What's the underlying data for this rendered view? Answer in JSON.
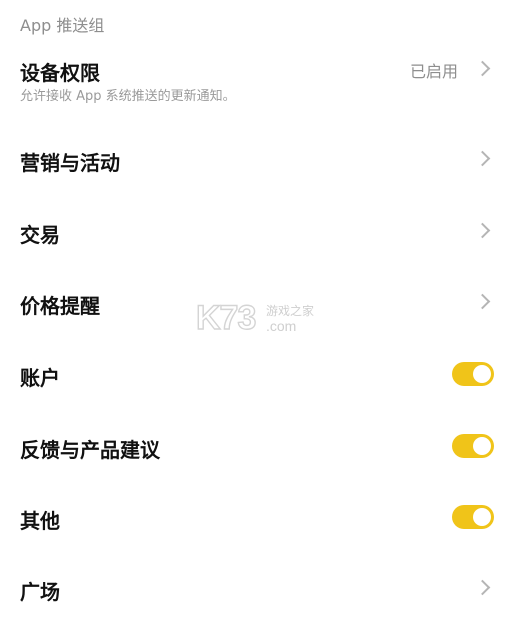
{
  "section_header": "App 推送组",
  "rows": [
    {
      "title": "设备权限",
      "subtitle": "允许接收 App 系统推送的更新通知。",
      "status": "已启用",
      "control": "chevron"
    },
    {
      "title": "营销与活动",
      "control": "chevron"
    },
    {
      "title": "交易",
      "control": "chevron"
    },
    {
      "title": "价格提醒",
      "control": "chevron"
    },
    {
      "title": "账户",
      "control": "toggle",
      "on": true
    },
    {
      "title": "反馈与产品建议",
      "control": "toggle",
      "on": true
    },
    {
      "title": "其他",
      "control": "toggle",
      "on": true
    },
    {
      "title": "广场",
      "control": "chevron"
    }
  ],
  "icons": {
    "chevron": "chevron-right-icon",
    "toggle": "toggle-switch"
  },
  "colors": {
    "accent": "#f0c419",
    "secondary_text": "#8e8e8e",
    "chevron": "#b5b5b5"
  },
  "watermark": {
    "brand": "K73",
    "tagline": "游戏之家",
    "domain": ".com"
  }
}
